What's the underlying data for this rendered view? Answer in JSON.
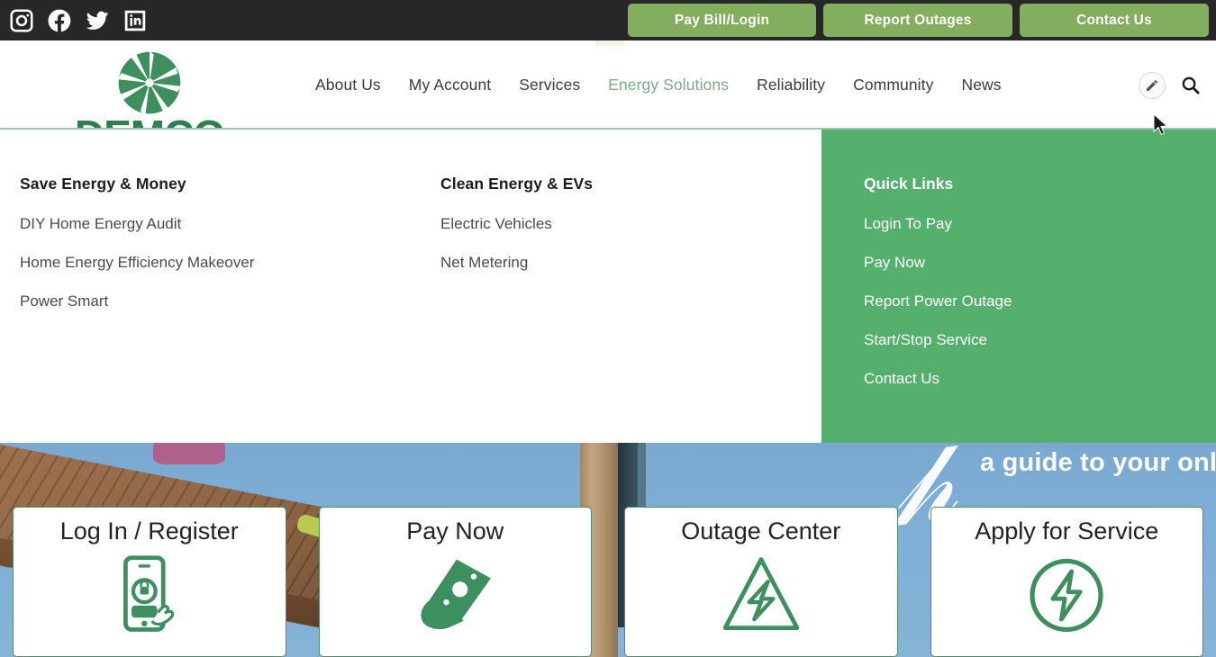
{
  "topbar": {
    "social": [
      {
        "name": "instagram-icon",
        "label": "Instagram"
      },
      {
        "name": "facebook-icon",
        "label": "Facebook"
      },
      {
        "name": "twitter-icon",
        "label": "Twitter"
      },
      {
        "name": "linkedin-icon",
        "label": "LinkedIn"
      }
    ],
    "buttons": [
      {
        "label": "Pay Bill/Login"
      },
      {
        "label": "Report Outages"
      },
      {
        "label": "Contact Us"
      }
    ],
    "background": "#272727",
    "button_color": "#83ae5d"
  },
  "header": {
    "logo_text": "DEMCO",
    "logo_color": "#2f8050",
    "nav": [
      {
        "label": "About Us",
        "active": false
      },
      {
        "label": "My Account",
        "active": false
      },
      {
        "label": "Services",
        "active": false
      },
      {
        "label": "Energy Solutions",
        "active": true
      },
      {
        "label": "Reliability",
        "active": false
      },
      {
        "label": "Community",
        "active": false
      },
      {
        "label": "News",
        "active": false
      }
    ],
    "active_color": "#7daa8a",
    "edit_icon": "pencil-icon",
    "search_icon": "search-icon"
  },
  "dropdown": {
    "columns": [
      {
        "heading": "Save Energy & Money",
        "links": [
          "DIY Home Energy Audit",
          "Home Energy Efficiency Makeover",
          "Power Smart"
        ]
      },
      {
        "heading": "Clean Energy & EVs",
        "links": [
          "Electric Vehicles",
          "Net Metering"
        ]
      }
    ],
    "quick_links": {
      "heading": "Quick Links",
      "background": "#55b06d",
      "links": [
        "Login To Pay",
        "Pay Now",
        "Report Power Outage",
        "Start/Stop Service",
        "Contact Us"
      ]
    }
  },
  "hero": {
    "banner_text": "a guide to your online e",
    "sky_color": "#7fb0d6"
  },
  "cards": [
    {
      "title": "Log In / Register",
      "icon": "phone-login-icon"
    },
    {
      "title": "Pay Now",
      "icon": "hand-cash-icon"
    },
    {
      "title": "Outage Center",
      "icon": "warning-bolt-icon"
    },
    {
      "title": "Apply for Service",
      "icon": "bolt-circle-icon"
    }
  ],
  "card_border_color": "#4f8f63"
}
